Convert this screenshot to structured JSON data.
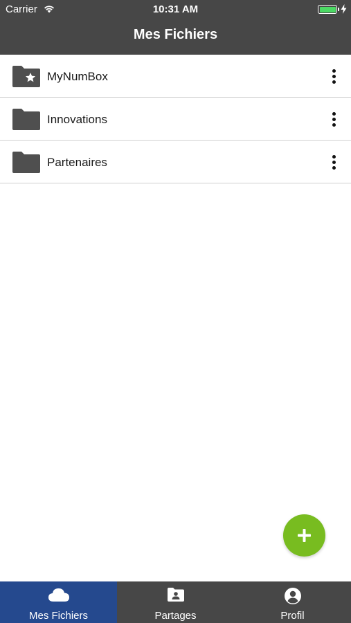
{
  "status_bar": {
    "carrier": "Carrier",
    "time": "10:31 AM"
  },
  "header": {
    "title": "Mes Fichiers"
  },
  "folders": [
    {
      "name": "MyNumBox",
      "icon": "starred-folder-icon"
    },
    {
      "name": "Innovations",
      "icon": "folder-icon"
    },
    {
      "name": "Partenaires",
      "icon": "folder-icon"
    }
  ],
  "fab": {
    "icon": "plus-icon",
    "color": "#78bc20"
  },
  "tabs": [
    {
      "label": "Mes Fichiers",
      "icon": "cloud-icon",
      "active": true
    },
    {
      "label": "Partages",
      "icon": "shared-folder-icon",
      "active": false
    },
    {
      "label": "Profil",
      "icon": "user-circle-icon",
      "active": false
    }
  ],
  "colors": {
    "header": "#474747",
    "active_tab": "#25498e",
    "folder": "#4f4f4f"
  }
}
